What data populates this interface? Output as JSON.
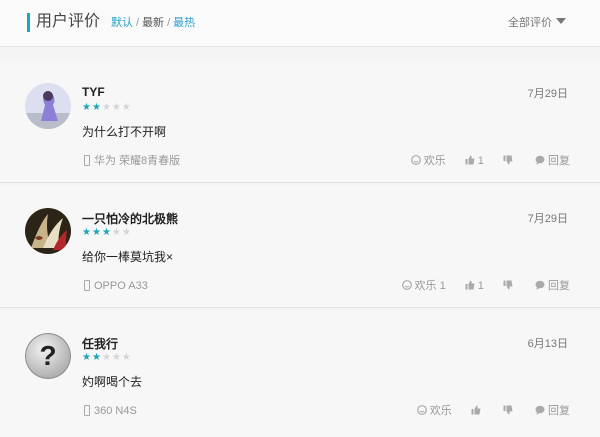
{
  "header": {
    "title": "用户评价",
    "sort_options": [
      {
        "label": "默认",
        "active": false
      },
      {
        "label": "最新",
        "active": true
      },
      {
        "label": "最热",
        "active": false
      }
    ],
    "filter_label": "全部评价"
  },
  "colors": {
    "accent": "#1fa5b8",
    "link": "#2aa0c7",
    "star_off": "#d5d5d5"
  },
  "reviews": [
    {
      "name": "TYF",
      "date": "7月29日",
      "rating": 2,
      "max_rating": 5,
      "content": "为什么打不开啊",
      "device": "华为 荣耀8青春版",
      "fun_label": "欢乐",
      "fun_count": "",
      "like_count": "1",
      "reply_label": "回复"
    },
    {
      "name": "一只怕冷的北极熊",
      "date": "7月29日",
      "rating": 3,
      "max_rating": 5,
      "content": "给你一棒莫坑我×",
      "device": "OPPO A33",
      "fun_label": "欢乐",
      "fun_count": "1",
      "like_count": "1",
      "reply_label": "回复"
    },
    {
      "name": "任我行",
      "date": "6月13日",
      "rating": 2,
      "max_rating": 5,
      "content": "妁啊喝个去",
      "device": "360 N4S",
      "fun_label": "欢乐",
      "fun_count": "",
      "like_count": "",
      "reply_label": "回复"
    }
  ]
}
